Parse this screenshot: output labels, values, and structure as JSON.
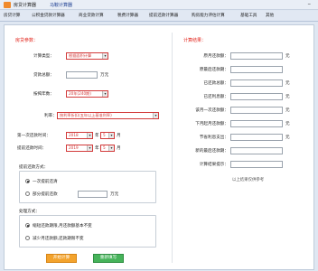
{
  "window": {
    "title": "房贷计算器",
    "menu_link": "马鞍计算器"
  },
  "tabs": [
    "房贷计算",
    "公积金贷款计算器",
    "商业贷款计算",
    "税费计算器",
    "提前还款计算器",
    "购房能力评估计算",
    "基础工具",
    "其他"
  ],
  "left": {
    "section_title": "房贷参数：",
    "calc_type_label": "计算类型：",
    "calc_type_value": "根据面积计算",
    "loan_amount_label": "贷款总额：",
    "loan_amount_unit": "万元",
    "loan_term_label": "按揭年数：",
    "loan_term_value": "20年(240期)",
    "rate_label": "利率：",
    "rate_value": "按利率折扣(五年以上基准利率)",
    "first_repay_label": "第一次还款时间：",
    "first_repay_year": "2018",
    "first_repay_year_unit": "年",
    "first_repay_month": "5",
    "first_repay_month_unit": "月",
    "prepay_label": "提前还款时间：",
    "prepay_year": "2019",
    "prepay_year_unit": "年",
    "prepay_month": "5",
    "prepay_month_unit": "月",
    "prepay_method_title": "提前还款方式：",
    "option_once": "一次提前还清",
    "option_partial": "部分提前还款",
    "partial_unit": "万元",
    "handling_title": "处理方式：",
    "option_shorten": "缩短还款期限,月还款额基本不变",
    "option_reduce": "减少月还款额,还款期限不变"
  },
  "right": {
    "section_title": "计算结果：",
    "rows": [
      {
        "label": "原月还款额：",
        "unit": "元"
      },
      {
        "label": "原最后还款期：",
        "unit": ""
      },
      {
        "label": "已还款总额：",
        "unit": "元"
      },
      {
        "label": "已还利息额：",
        "unit": "元"
      },
      {
        "label": "该月一次还款额：",
        "unit": "元"
      },
      {
        "label": "下月起月还款额：",
        "unit": "元"
      },
      {
        "label": "节省利息支出：",
        "unit": "元"
      },
      {
        "label": "新的最后还款期：",
        "unit": ""
      },
      {
        "label": "计算结果提示：",
        "unit": ""
      }
    ],
    "note": "以上结果仅供参考"
  },
  "buttons": {
    "calculate": "开始计算",
    "reset": "重新填写"
  },
  "colors": {
    "accent_red": "#e2231a",
    "orange": "#f3a32d",
    "green": "#46b35a"
  }
}
